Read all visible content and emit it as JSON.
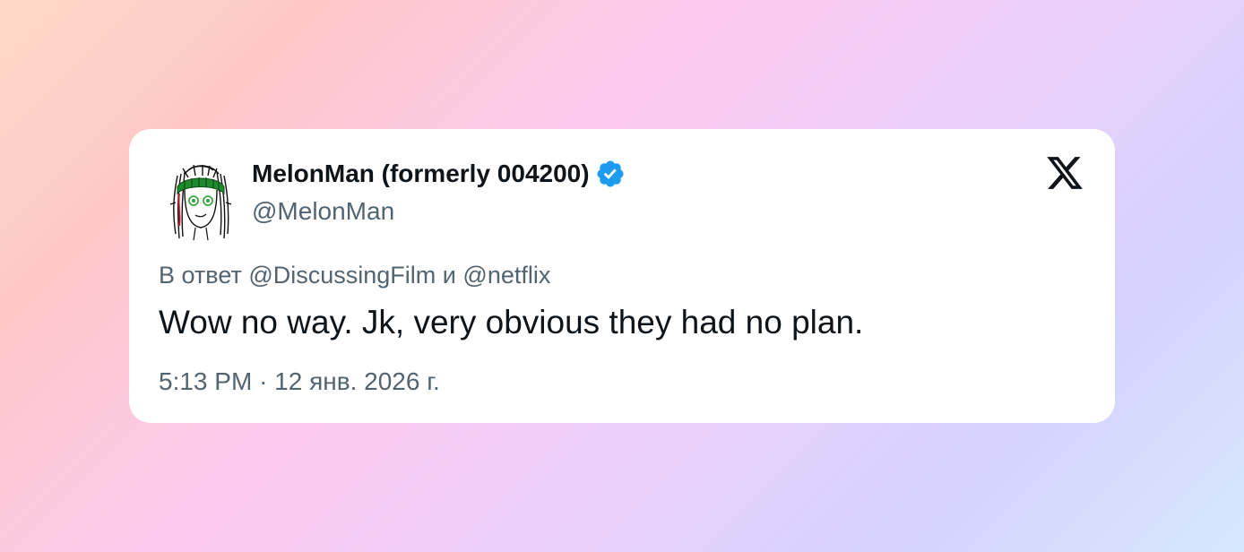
{
  "tweet": {
    "author": {
      "display_name": "MelonMan (formerly 004200)",
      "handle": "@MelonMan",
      "verified": true,
      "verified_badge_color": "#1d9bf0",
      "avatar_icon": "melon-head-avatar"
    },
    "platform_logo": "x-logo-icon",
    "reply": {
      "prefix": "В ответ",
      "mention_1": "@DiscussingFilm",
      "conjunction": "и",
      "mention_2": "@netflix"
    },
    "text": "Wow no way. Jk, very obvious they had no plan.",
    "timestamp": {
      "time": "5:13 PM",
      "separator": "·",
      "date": "12 янв. 2026 г."
    }
  },
  "colors": {
    "text_primary": "#0f1419",
    "text_secondary": "#536471",
    "card_background": "#ffffff"
  }
}
